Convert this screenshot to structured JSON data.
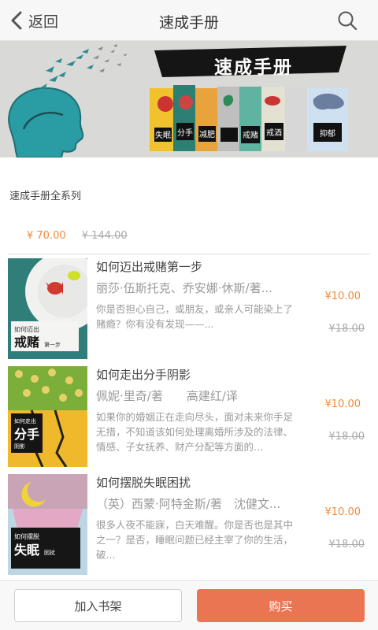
{
  "nav": {
    "back_label": "返回",
    "title": "速成手册"
  },
  "banner": {
    "title": "速成手册",
    "mini_covers": [
      "失眠",
      "分手",
      "减肥",
      "戒赌",
      "戒酒",
      "抑郁"
    ]
  },
  "series": {
    "title": "速成手册全系列",
    "price": "¥ 70.00",
    "original_price": "¥ 144.00"
  },
  "books": [
    {
      "title": "如何迈出戒赌第一步",
      "author": "丽莎·伍斯托克、乔安娜·休斯/著...",
      "desc": "你是否担心自己，或朋友，或亲人可能染上了赌瘾？你有没有发现——...",
      "price": "¥10.00",
      "original_price": "¥18.00",
      "cover_title": "戒赌",
      "cover_pre": "如何迈出",
      "cover_sub": "第一步"
    },
    {
      "title": "如何走出分手阴影",
      "author": "佩妮·里奇/著　　高建红/译",
      "desc": "如果你的婚姻正在走向尽头，面对未来你手足无措，不知道该如何处理离婚所涉及的法律、情感、子女抚养、财产分配等方面的...",
      "price": "¥10.00",
      "original_price": "¥18.00",
      "cover_title": "分手",
      "cover_pre": "如何走出",
      "cover_sub": "阴影"
    },
    {
      "title": "如何摆脱失眠困扰",
      "author": "（英）西蒙·阿特金斯/著　沈健文...",
      "desc": "很多人夜不能寐，白天难醒。你是否也是其中之一？是否，睡眠问题已经主宰了你的生活，破...",
      "price": "¥10.00",
      "original_price": "¥18.00",
      "cover_title": "失眠",
      "cover_pre": "如何摆脱",
      "cover_sub": "困扰"
    }
  ],
  "actions": {
    "add_to_shelf": "加入书架",
    "buy": "购买"
  },
  "colors": {
    "accent": "#ea7552",
    "price": "#f08a3c"
  }
}
